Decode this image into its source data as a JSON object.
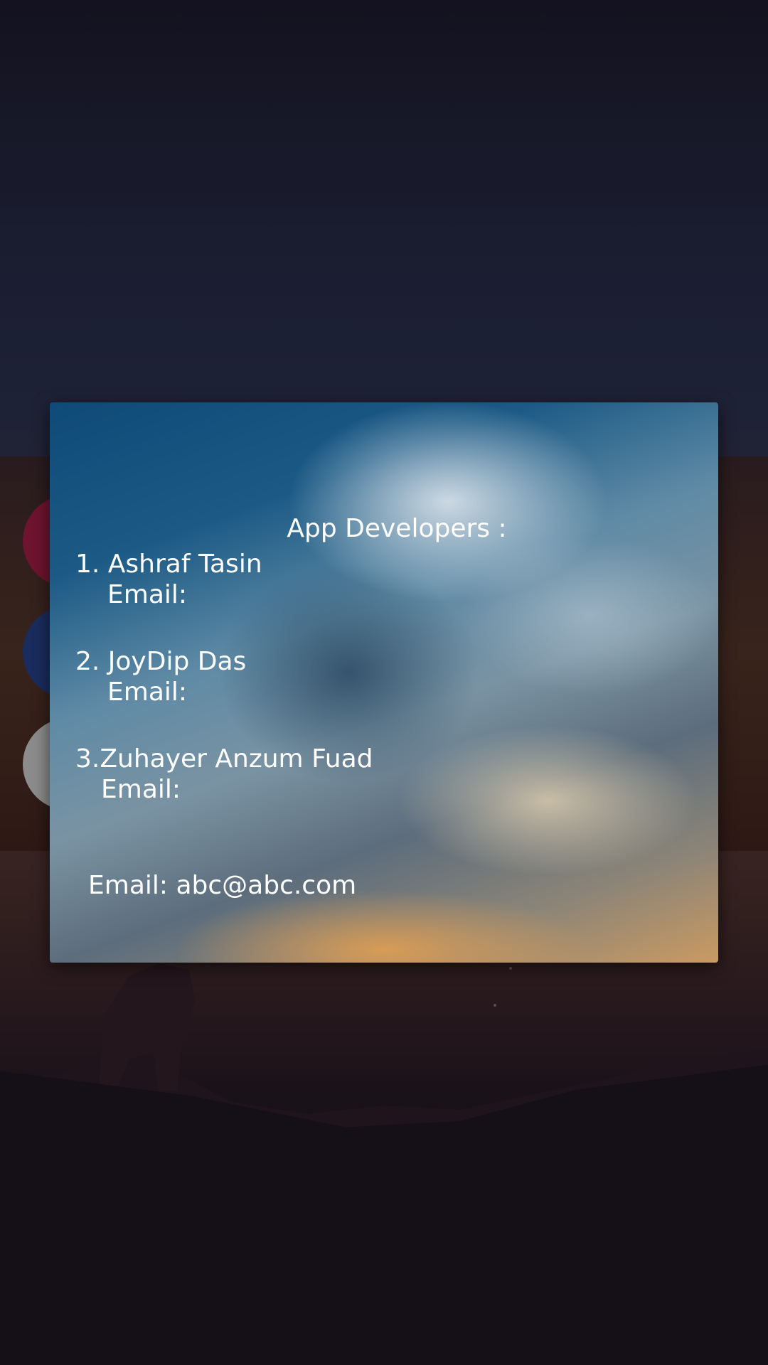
{
  "dialog": {
    "title": "App Developers :",
    "developers": [
      {
        "name": "1. Ashraf Tasin",
        "email_label": "Email:"
      },
      {
        "name": "2. JoyDip Das",
        "email_label": "Email:"
      },
      {
        "name": "3.Zuhayer Anzum Fuad",
        "email_label": "Email:"
      }
    ],
    "contact_email": "Email: abc@abc.com"
  },
  "background": {
    "circles": [
      {
        "name": "red",
        "color": "#6e1430"
      },
      {
        "name": "blue",
        "color": "#1a2c5e"
      },
      {
        "name": "gray",
        "color": "#8c8c8c"
      }
    ]
  }
}
